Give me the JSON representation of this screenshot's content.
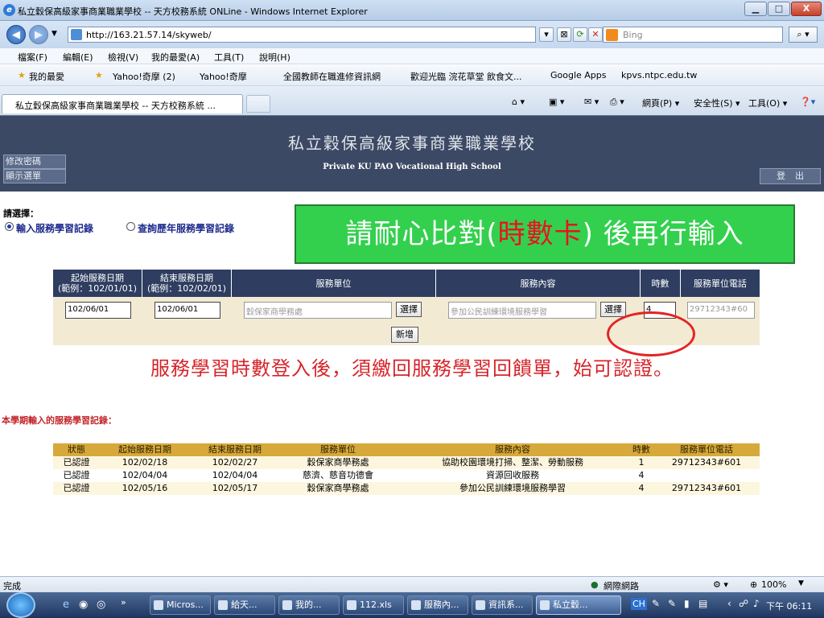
{
  "window": {
    "title": "私立穀保高級家事商業職業學校 -- 天方校務系統 ONLine - Windows Internet Explorer",
    "min": "▁",
    "max": "□",
    "close": "X"
  },
  "address": {
    "url": "http://163.21.57.14/skyweb/",
    "search_placeholder": "Bing"
  },
  "menu": [
    "檔案(F)",
    "編輯(E)",
    "檢視(V)",
    "我的最愛(A)",
    "工具(T)",
    "說明(H)"
  ],
  "favorites": {
    "label": "我的最愛",
    "items": [
      "Yahoo!奇摩 (2)",
      "Yahoo!奇摩",
      "全國教師在職進修資訊網",
      "歡迎光臨 浣花草堂 飲食文...",
      "Google Apps",
      "kpvs.ntpc.edu.tw"
    ]
  },
  "tab": {
    "label": "私立穀保高級家事商業職業學校 -- 天方校務系統 ...",
    "tools": [
      "網頁(P) ▾",
      "安全性(S) ▾",
      "工具(O) ▾"
    ]
  },
  "header": {
    "title_cn": "私立穀保高級家事商業職業學校",
    "title_en": "Private KU PAO Vocational High School",
    "change_password": "修改密碼",
    "show_menu": "顯示選單",
    "logout": "登出"
  },
  "select": {
    "label": "請選擇：",
    "option1": "輸入服務學習記錄",
    "option2": "查詢歷年服務學習記錄"
  },
  "notice": {
    "before": "請耐心比對(",
    "highlight": "時數卡",
    "after": ") 後再行輸入"
  },
  "entry": {
    "headers": [
      "起始服務日期\n(範例：102/01/01)",
      "結束服務日期\n(範例：102/02/01)",
      "服務單位",
      "服務內容",
      "時數",
      "服務單位電話"
    ],
    "start_date": "102/06/01",
    "end_date": "102/06/01",
    "unit": "穀保家商學務處",
    "content": "參加公民訓練環境服務學習",
    "hours": "4",
    "phone": "29712343#60",
    "select_button": "選擇",
    "add_button": "新增"
  },
  "warning": "服務學習時數登入後，須繳回服務學習回饋單，始可認證。",
  "records": {
    "title": "本學期輸入的服務學習記錄：",
    "headers": [
      "狀態",
      "起始服務日期",
      "結束服務日期",
      "服務單位",
      "服務內容",
      "時數",
      "服務單位電話"
    ],
    "rows": [
      [
        "已認證",
        "102/02/18",
        "102/02/27",
        "穀保家商學務處",
        "協助校園環境打掃、整潔、勞動服務",
        "1",
        "29712343#601"
      ],
      [
        "已認證",
        "102/04/04",
        "102/04/04",
        "慈濟、慈音功德會",
        "資源回收服務",
        "4",
        ""
      ],
      [
        "已認證",
        "102/05/16",
        "102/05/17",
        "穀保家商學務處",
        "參加公民訓練環境服務學習",
        "4",
        "29712343#601"
      ]
    ]
  },
  "status": {
    "left": "完成",
    "zone": "網際網路",
    "zoom": "100%"
  },
  "taskbar": {
    "items": [
      "Micros...",
      "給天...",
      "我的...",
      "112.xls",
      "服務內...",
      "資訊系...",
      "私立穀..."
    ],
    "tray": "CH",
    "clock": "下午 06:11"
  },
  "colors": {
    "header_bg": "#3c4964",
    "notice_bg": "#33d04e",
    "notice_highlight": "#e8141e",
    "warning": "#d6242a",
    "record_header": "#d6a93a",
    "entry_header": "#2e3d60"
  }
}
